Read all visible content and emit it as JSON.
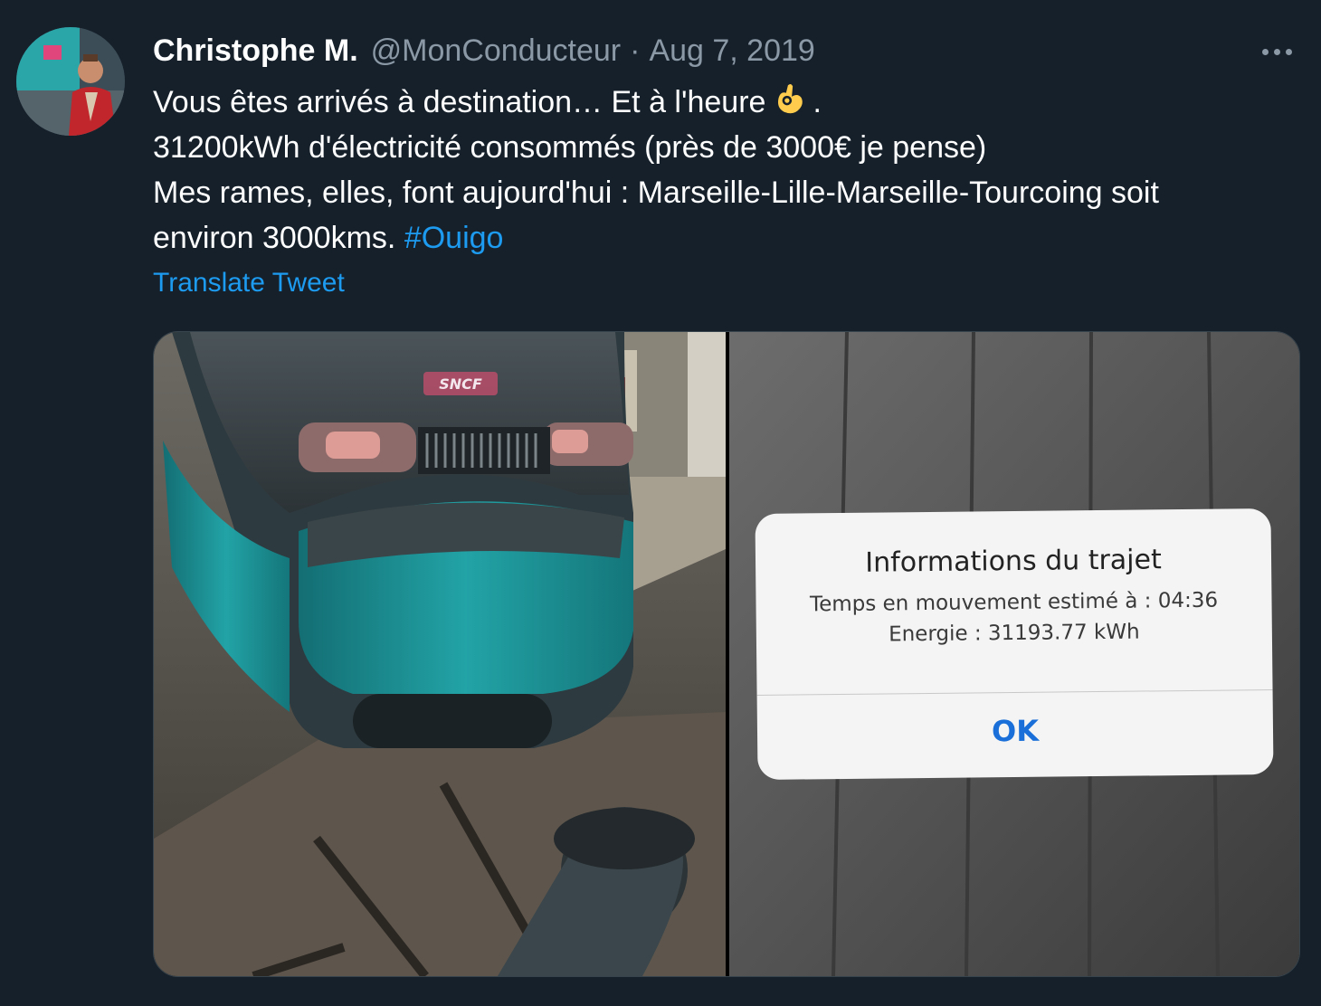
{
  "tweet": {
    "display_name": "Christophe M.",
    "handle": "@MonConducteur",
    "separator": "·",
    "date": "Aug 7, 2019",
    "text_line1": "Vous êtes arrivés à destination… Et à l'heure",
    "text_line1_end": ".",
    "text_line2": "31200kWh d'électricité consommés (près de 3000€ je pense)",
    "text_line3": "Mes rames, elles, font aujourd'hui : Marseille-Lille-Marseille-Tourcoing soit",
    "text_line4": "environ 3000kms.",
    "hashtag": "#Ouigo",
    "translate_label": "Translate Tweet"
  },
  "media": {
    "left_photo": {
      "logo_text": "SNCF"
    },
    "right_photo": {
      "dialog_title": "Informations du trajet",
      "dialog_line1": "Temps en mouvement estimé à : 04:36",
      "dialog_line2": "Energie : 31193.77 kWh",
      "dialog_button": "OK"
    }
  },
  "icons": {
    "more": "more-horizontal-icon",
    "emoji": "ok-hand-emoji"
  },
  "colors": {
    "background": "#15202b",
    "link": "#1d9bf0",
    "secondary_text": "#8b98a5",
    "train_teal": "#1f9aa0"
  }
}
